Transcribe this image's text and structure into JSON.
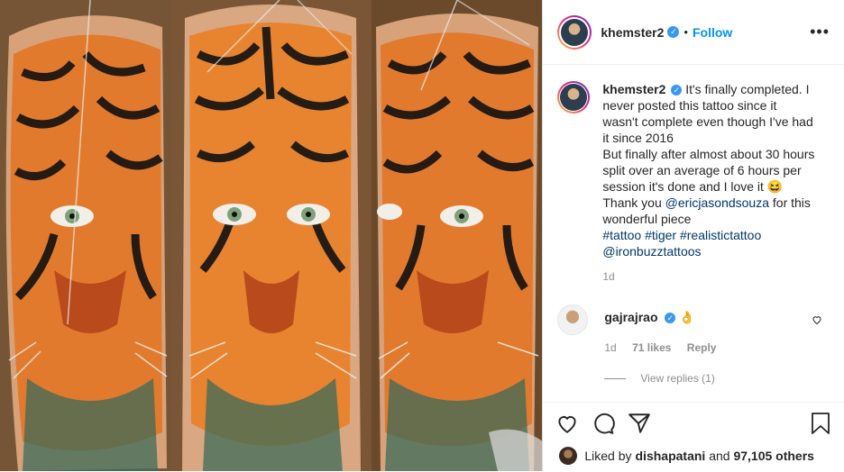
{
  "post": {
    "username": "khemster2",
    "verified": true,
    "separator": "•",
    "follow_label": "Follow",
    "more_label": "•••"
  },
  "caption": {
    "username": "khemster2",
    "line1": " It's finally completed. I never posted this tattoo since it wasn't complete even though I've had it since 2016",
    "line2": "But finally after almost about 30 hours split over an average of 6 hours per session it's done and I love it 😆",
    "thanks_prefix": "Thank you ",
    "thanks_mention": "@ericjasondsouza",
    "thanks_suffix": " for this wonderful piece",
    "hashtags": "#tattoo #tiger #realistictattoo",
    "mention2": "@ironbuzztattoos",
    "age": "1d"
  },
  "comment": {
    "username": "gajrajrao",
    "emoji": "👌",
    "age": "1d",
    "likes": "71 likes",
    "reply": "Reply",
    "view_replies": "View replies (1)"
  },
  "likes": {
    "prefix": "Liked by ",
    "user": "dishapatani",
    "suffix": " and ",
    "count": "97,105 others"
  },
  "icons": {
    "like": "heart-icon",
    "comment": "comment-icon",
    "share": "share-icon",
    "save": "bookmark-icon"
  },
  "colors": {
    "accent": "#0095f6",
    "verified": "#3897f0",
    "link": "#00376b",
    "muted": "#8e8e8e"
  }
}
